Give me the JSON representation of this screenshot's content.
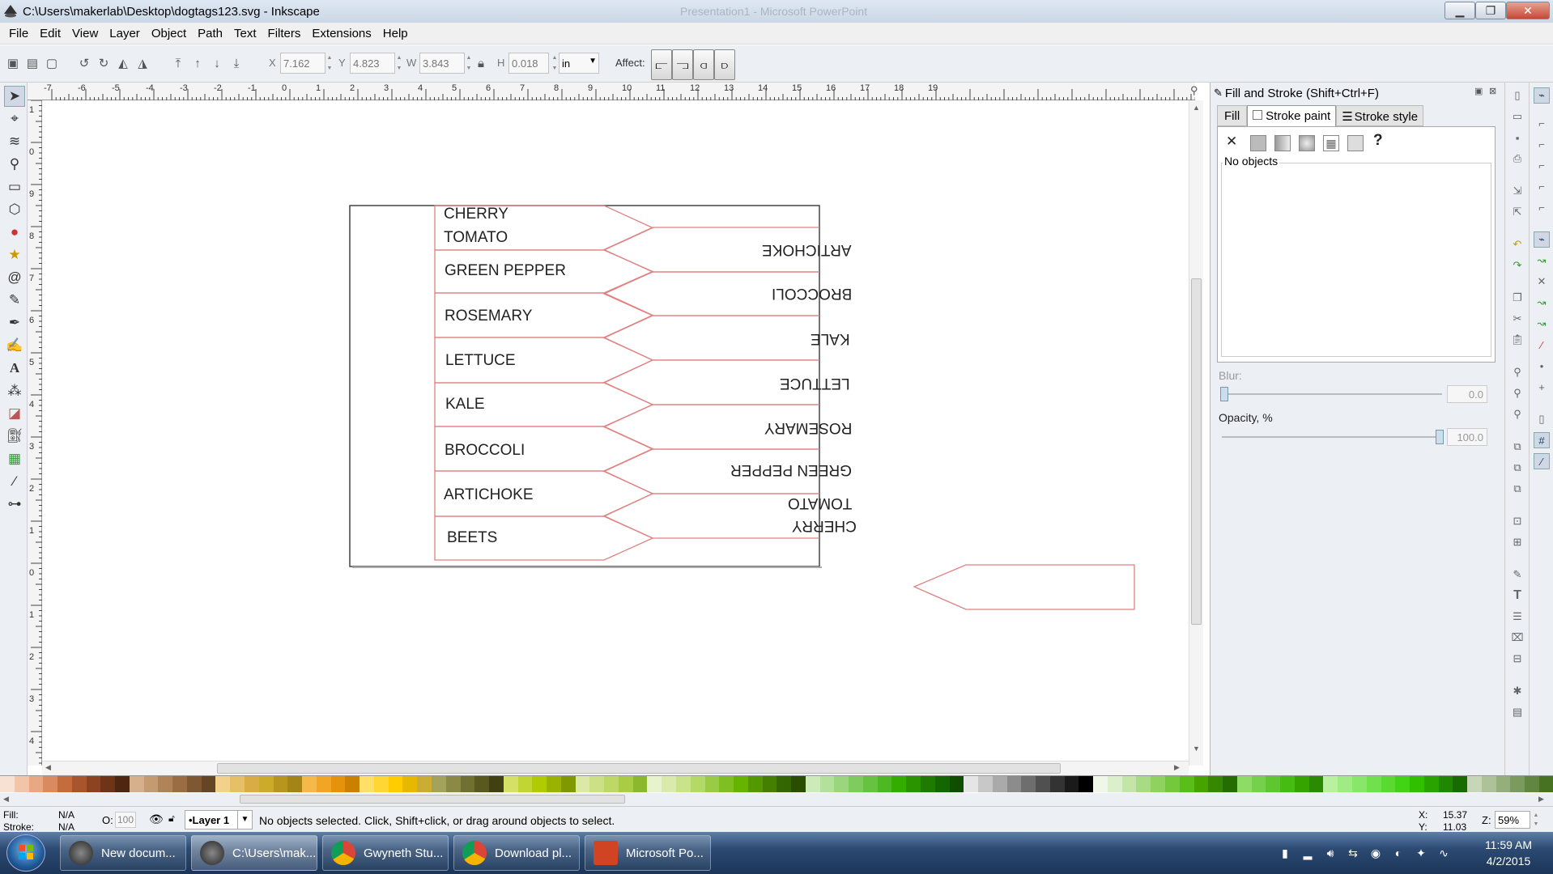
{
  "window": {
    "title": "C:\\Users\\makerlab\\Desktop\\dogtags123.svg - Inkscape",
    "background_title": "Presentation1 - Microsoft PowerPoint"
  },
  "menu": [
    "File",
    "Edit",
    "View",
    "Layer",
    "Object",
    "Path",
    "Text",
    "Filters",
    "Extensions",
    "Help"
  ],
  "controls": {
    "x_label": "X",
    "x_value": "7.162",
    "y_label": "Y",
    "y_value": "4.823",
    "w_label": "W",
    "w_value": "3.843",
    "h_label": "H",
    "h_value": "0.018",
    "unit": "in",
    "affect_label": "Affect:"
  },
  "rulers": {
    "h": [
      "-7",
      "-6",
      "-5",
      "-4",
      "-3",
      "-2",
      "-1",
      "0",
      "1",
      "2",
      "3",
      "4",
      "5",
      "6",
      "7",
      "8",
      "9",
      "10",
      "11",
      "12",
      "13",
      "14",
      "15",
      "16",
      "17",
      "18",
      "19"
    ],
    "v": [
      "1",
      "0",
      "9",
      "8",
      "7",
      "6",
      "5",
      "4",
      "3",
      "2",
      "1",
      "0",
      "1",
      "2",
      "3",
      "4"
    ]
  },
  "canvas": {
    "left_tags": [
      "CHERRY",
      "TOMATO",
      "GREEN PEPPER",
      "ROSEMARY",
      "LETTUCE",
      "KALE",
      "BROCCOLI",
      "ARTICHOKE",
      "BEETS"
    ],
    "right_tags": [
      "ARTICHOKE",
      "BROCCOLI",
      "KALE",
      "LETTUCE",
      "ROSEMARY",
      "GREEN PEPPER",
      "TOMATO",
      "CHERRY"
    ],
    "tag_color": "#e08080"
  },
  "dialog": {
    "title": "Fill and Stroke (Shift+Ctrl+F)",
    "tabs": [
      "Fill",
      "Stroke paint",
      "Stroke style"
    ],
    "active_tab": "Stroke paint",
    "paint_x": "✕",
    "paint_unknown": "?",
    "no_objects": "No objects",
    "blur_label": "Blur:",
    "blur_value": "0.0",
    "opacity_label": "Opacity, %",
    "opacity_value": "100.0"
  },
  "status": {
    "fill_label": "Fill:",
    "fill_value": "N/A",
    "stroke_label": "Stroke:",
    "stroke_value": "N/A",
    "o_label": "O:",
    "o_value": "100",
    "layer": "•Layer 1",
    "message": "No objects selected. Click, Shift+click, or drag around objects to select.",
    "x_label": "X:",
    "x_value": "15.37",
    "y_label": "Y:",
    "y_value": "11.03",
    "z_label": "Z:",
    "zoom": "59%"
  },
  "taskbar": {
    "items": [
      "New docum...",
      "C:\\Users\\mak...",
      "Gwyneth Stu...",
      "Download pl...",
      "Microsoft Po..."
    ],
    "time": "11:59 AM",
    "date": "4/2/2015"
  }
}
